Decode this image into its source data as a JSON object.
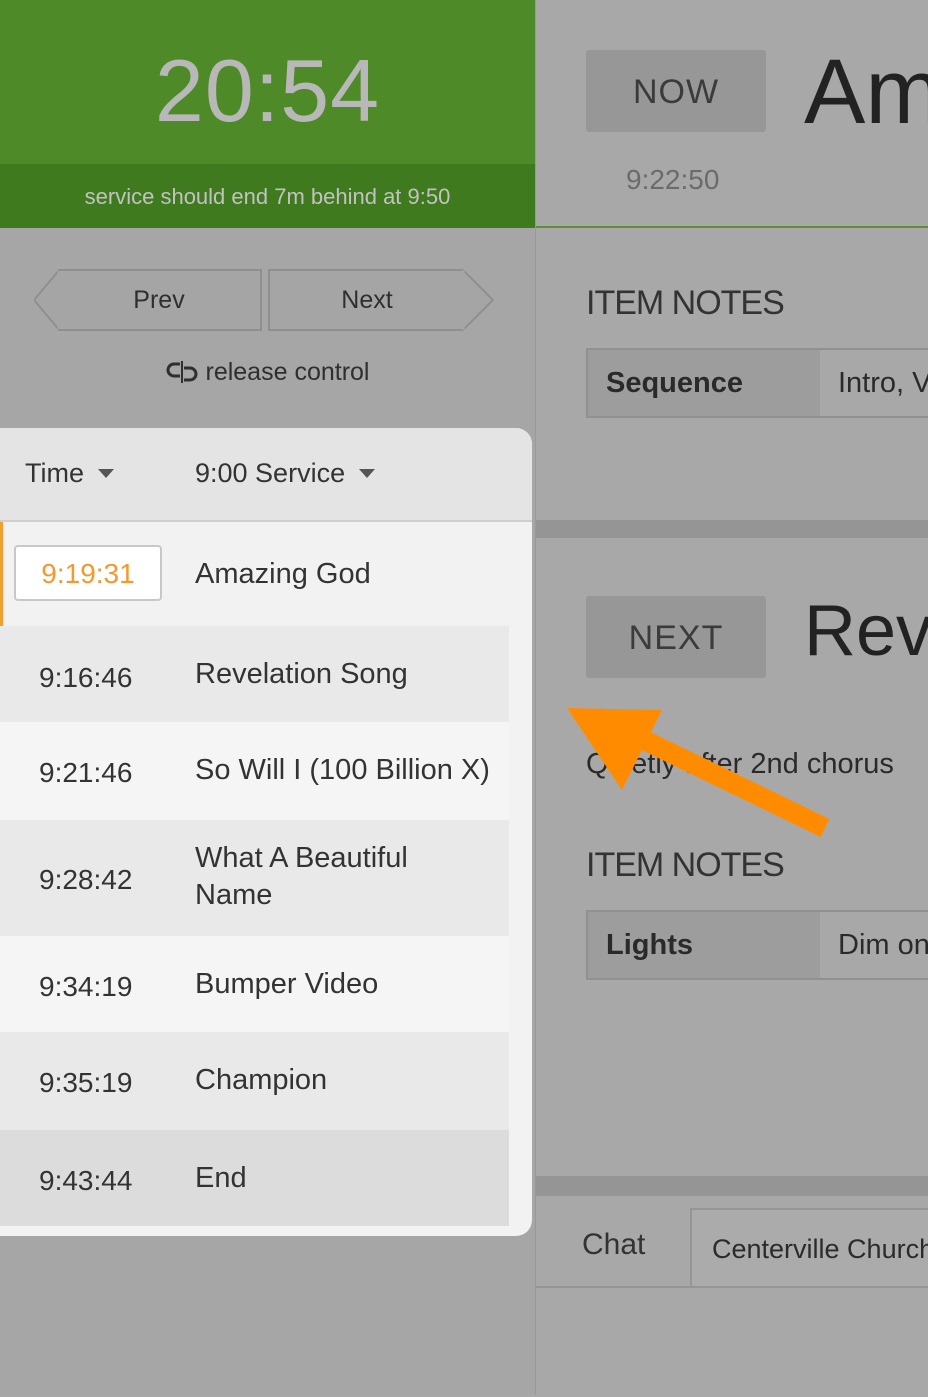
{
  "timer": {
    "value": "20:54",
    "status": "service should end 7m behind at 9:50"
  },
  "nav": {
    "prev_label": "Prev",
    "next_label": "Next",
    "release_label": "release control"
  },
  "plan": {
    "header": {
      "time_label": "Time",
      "service_label": "9:00 Service"
    },
    "items": [
      {
        "time": "9:19:31",
        "name": "Amazing God",
        "current": true
      },
      {
        "time": "9:16:46",
        "name": "Revelation Song"
      },
      {
        "time": "9:21:46",
        "name": "So Will I (100 Billion X)"
      },
      {
        "time": "9:28:42",
        "name": "What A Beautiful Name"
      },
      {
        "time": "9:34:19",
        "name": "Bumper Video"
      },
      {
        "time": "9:35:19",
        "name": "Champion"
      },
      {
        "time": "9:43:44",
        "name": "End"
      }
    ]
  },
  "now_panel": {
    "badge": "NOW",
    "title": "Am",
    "time": "9:22:50",
    "notes_label": "ITEM NOTES",
    "note_key": "Sequence",
    "note_value": "Intro, V"
  },
  "next_panel": {
    "badge": "NEXT",
    "title": "Reve",
    "comment": "Quietly after 2nd chorus",
    "notes_label": "ITEM NOTES",
    "note_key": "Lights",
    "note_value": "Dim on"
  },
  "chat": {
    "tab_chat": "Chat",
    "tab_church": "Centerville Church"
  },
  "colors": {
    "timer_green": "#4f8a28",
    "current_time": "#f29a2e",
    "annotation_arrow": "#ff8c00"
  }
}
